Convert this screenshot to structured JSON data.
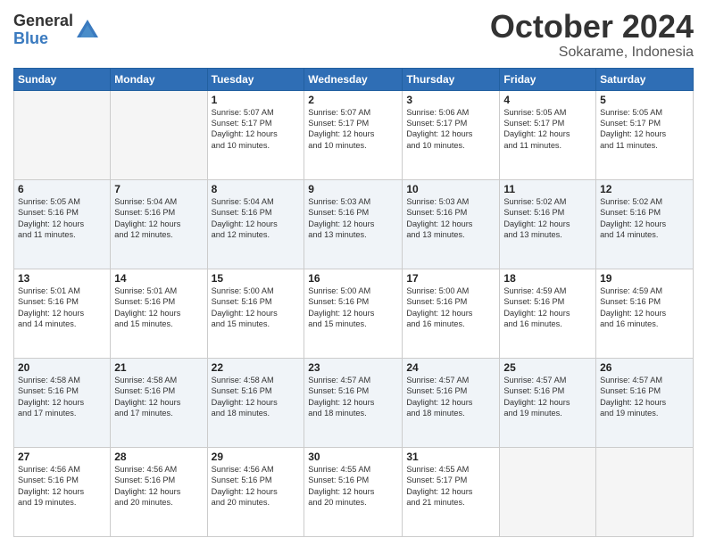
{
  "header": {
    "logo_general": "General",
    "logo_blue": "Blue",
    "month_title": "October 2024",
    "location": "Sokarame, Indonesia"
  },
  "weekdays": [
    "Sunday",
    "Monday",
    "Tuesday",
    "Wednesday",
    "Thursday",
    "Friday",
    "Saturday"
  ],
  "weeks": [
    [
      {
        "day": "",
        "detail": ""
      },
      {
        "day": "",
        "detail": ""
      },
      {
        "day": "1",
        "detail": "Sunrise: 5:07 AM\nSunset: 5:17 PM\nDaylight: 12 hours\nand 10 minutes."
      },
      {
        "day": "2",
        "detail": "Sunrise: 5:07 AM\nSunset: 5:17 PM\nDaylight: 12 hours\nand 10 minutes."
      },
      {
        "day": "3",
        "detail": "Sunrise: 5:06 AM\nSunset: 5:17 PM\nDaylight: 12 hours\nand 10 minutes."
      },
      {
        "day": "4",
        "detail": "Sunrise: 5:05 AM\nSunset: 5:17 PM\nDaylight: 12 hours\nand 11 minutes."
      },
      {
        "day": "5",
        "detail": "Sunrise: 5:05 AM\nSunset: 5:17 PM\nDaylight: 12 hours\nand 11 minutes."
      }
    ],
    [
      {
        "day": "6",
        "detail": "Sunrise: 5:05 AM\nSunset: 5:16 PM\nDaylight: 12 hours\nand 11 minutes."
      },
      {
        "day": "7",
        "detail": "Sunrise: 5:04 AM\nSunset: 5:16 PM\nDaylight: 12 hours\nand 12 minutes."
      },
      {
        "day": "8",
        "detail": "Sunrise: 5:04 AM\nSunset: 5:16 PM\nDaylight: 12 hours\nand 12 minutes."
      },
      {
        "day": "9",
        "detail": "Sunrise: 5:03 AM\nSunset: 5:16 PM\nDaylight: 12 hours\nand 13 minutes."
      },
      {
        "day": "10",
        "detail": "Sunrise: 5:03 AM\nSunset: 5:16 PM\nDaylight: 12 hours\nand 13 minutes."
      },
      {
        "day": "11",
        "detail": "Sunrise: 5:02 AM\nSunset: 5:16 PM\nDaylight: 12 hours\nand 13 minutes."
      },
      {
        "day": "12",
        "detail": "Sunrise: 5:02 AM\nSunset: 5:16 PM\nDaylight: 12 hours\nand 14 minutes."
      }
    ],
    [
      {
        "day": "13",
        "detail": "Sunrise: 5:01 AM\nSunset: 5:16 PM\nDaylight: 12 hours\nand 14 minutes."
      },
      {
        "day": "14",
        "detail": "Sunrise: 5:01 AM\nSunset: 5:16 PM\nDaylight: 12 hours\nand 15 minutes."
      },
      {
        "day": "15",
        "detail": "Sunrise: 5:00 AM\nSunset: 5:16 PM\nDaylight: 12 hours\nand 15 minutes."
      },
      {
        "day": "16",
        "detail": "Sunrise: 5:00 AM\nSunset: 5:16 PM\nDaylight: 12 hours\nand 15 minutes."
      },
      {
        "day": "17",
        "detail": "Sunrise: 5:00 AM\nSunset: 5:16 PM\nDaylight: 12 hours\nand 16 minutes."
      },
      {
        "day": "18",
        "detail": "Sunrise: 4:59 AM\nSunset: 5:16 PM\nDaylight: 12 hours\nand 16 minutes."
      },
      {
        "day": "19",
        "detail": "Sunrise: 4:59 AM\nSunset: 5:16 PM\nDaylight: 12 hours\nand 16 minutes."
      }
    ],
    [
      {
        "day": "20",
        "detail": "Sunrise: 4:58 AM\nSunset: 5:16 PM\nDaylight: 12 hours\nand 17 minutes."
      },
      {
        "day": "21",
        "detail": "Sunrise: 4:58 AM\nSunset: 5:16 PM\nDaylight: 12 hours\nand 17 minutes."
      },
      {
        "day": "22",
        "detail": "Sunrise: 4:58 AM\nSunset: 5:16 PM\nDaylight: 12 hours\nand 18 minutes."
      },
      {
        "day": "23",
        "detail": "Sunrise: 4:57 AM\nSunset: 5:16 PM\nDaylight: 12 hours\nand 18 minutes."
      },
      {
        "day": "24",
        "detail": "Sunrise: 4:57 AM\nSunset: 5:16 PM\nDaylight: 12 hours\nand 18 minutes."
      },
      {
        "day": "25",
        "detail": "Sunrise: 4:57 AM\nSunset: 5:16 PM\nDaylight: 12 hours\nand 19 minutes."
      },
      {
        "day": "26",
        "detail": "Sunrise: 4:57 AM\nSunset: 5:16 PM\nDaylight: 12 hours\nand 19 minutes."
      }
    ],
    [
      {
        "day": "27",
        "detail": "Sunrise: 4:56 AM\nSunset: 5:16 PM\nDaylight: 12 hours\nand 19 minutes."
      },
      {
        "day": "28",
        "detail": "Sunrise: 4:56 AM\nSunset: 5:16 PM\nDaylight: 12 hours\nand 20 minutes."
      },
      {
        "day": "29",
        "detail": "Sunrise: 4:56 AM\nSunset: 5:16 PM\nDaylight: 12 hours\nand 20 minutes."
      },
      {
        "day": "30",
        "detail": "Sunrise: 4:55 AM\nSunset: 5:16 PM\nDaylight: 12 hours\nand 20 minutes."
      },
      {
        "day": "31",
        "detail": "Sunrise: 4:55 AM\nSunset: 5:17 PM\nDaylight: 12 hours\nand 21 minutes."
      },
      {
        "day": "",
        "detail": ""
      },
      {
        "day": "",
        "detail": ""
      }
    ]
  ]
}
